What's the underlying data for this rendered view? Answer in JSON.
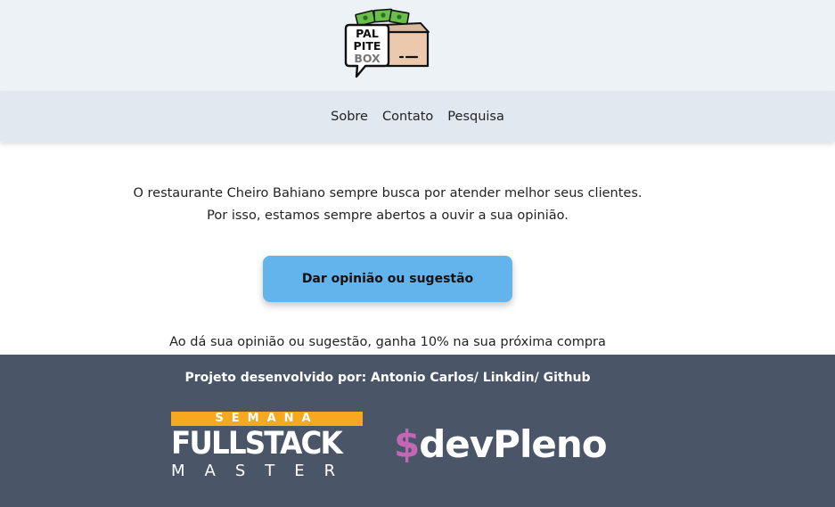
{
  "header": {
    "logo_text": [
      "PAL",
      "PITE",
      "BOX"
    ]
  },
  "nav": {
    "items": [
      {
        "label": "Sobre"
      },
      {
        "label": "Contato"
      },
      {
        "label": "Pesquisa"
      }
    ]
  },
  "main": {
    "intro_line1": "O restaurante Cheiro Bahiano sempre busca por atender melhor seus clientes.",
    "intro_line2": "Por isso, estamos sempre abertos a ouvir a sua opinião.",
    "cta_label": "Dar opinião ou sugestão",
    "promo": "Ao dá sua opinião ou sugestão, ganha 10% na sua próxima compra"
  },
  "footer": {
    "credits_prefix": "Projeto desenvolvido por: ",
    "author": "Antonio Carlos",
    "sep1": "/ ",
    "linkedin": "Linkdin",
    "sep2": "/ ",
    "github": "Github",
    "fsm_top": "SEMANA",
    "fsm_main": "FULLSTACK",
    "fsm_sub": "MASTER",
    "devpleno_symbol": "$",
    "devpleno_text": "devPleno"
  },
  "colors": {
    "header_bg": "#edf2f7",
    "nav_bg": "#e2e8f0",
    "button_bg": "#63b3ed",
    "footer_bg": "#4a5568",
    "fsm_accent": "#f6a81e",
    "devpleno_accent": "#c267b5"
  }
}
